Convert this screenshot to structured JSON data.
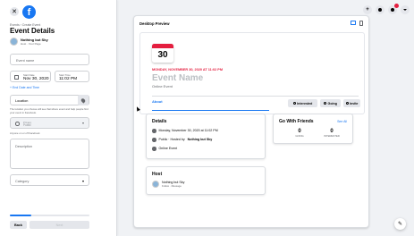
{
  "sidebar": {
    "breadcrumb": "Events › Create Event",
    "title": "Event Details",
    "host": {
      "name": "Nothing but Sky",
      "sub": "Host · Your Page"
    },
    "event_name_placeholder": "Event name",
    "start_date_label": "Start Date",
    "start_date_value": "Nov 30, 2020",
    "start_time_label": "Start Time",
    "start_time_value": "11:02 PM",
    "end_date_link": "+ End Date and Time",
    "location_placeholder": "Location",
    "location_help": "The location you choose will see that where event and help people find your event in Facebook.",
    "privacy_label": "Privacy",
    "privacy_value": "Public",
    "privacy_help": "Anyone on or off Facebook",
    "description_placeholder": "Description",
    "category_placeholder": "Category",
    "progress_fraction": 0.27,
    "back_label": "Back",
    "next_label": "Next"
  },
  "topbar": {
    "plus_icon": "+",
    "messenger_icon": "messenger-icon",
    "notifications_icon": "bell-icon",
    "account_icon": "caret-down-icon"
  },
  "preview": {
    "title": "Desktop Preview",
    "calendar_day": "30",
    "date_line": "MONDAY, NOVEMBER 30, 2020 AT 11:02 PM",
    "event_name": "Event Name",
    "event_type": "Online Event",
    "tab_about": "About",
    "btn_interested": "Interested",
    "btn_going": "Going",
    "btn_invite": "Invite",
    "details": {
      "heading": "Details",
      "row1": "Monday, November 30, 2020 at 11:02 PM",
      "row2_prefix": "Public · Hosted by",
      "row2_host": "Nothing but Sky",
      "row3": "Online Event"
    },
    "friends": {
      "heading": "Go With Friends",
      "see_all": "See All",
      "going_count": "0",
      "going_label": "GOING",
      "interested_count": "0",
      "interested_label": "INTERESTED"
    },
    "host_card": {
      "heading": "Host",
      "name": "Nothing but Sky",
      "sub": "Follow · Message"
    }
  },
  "colors": {
    "brand_blue": "#1877f2",
    "date_red": "#e41e3f",
    "bg": "#f0f2f5"
  }
}
